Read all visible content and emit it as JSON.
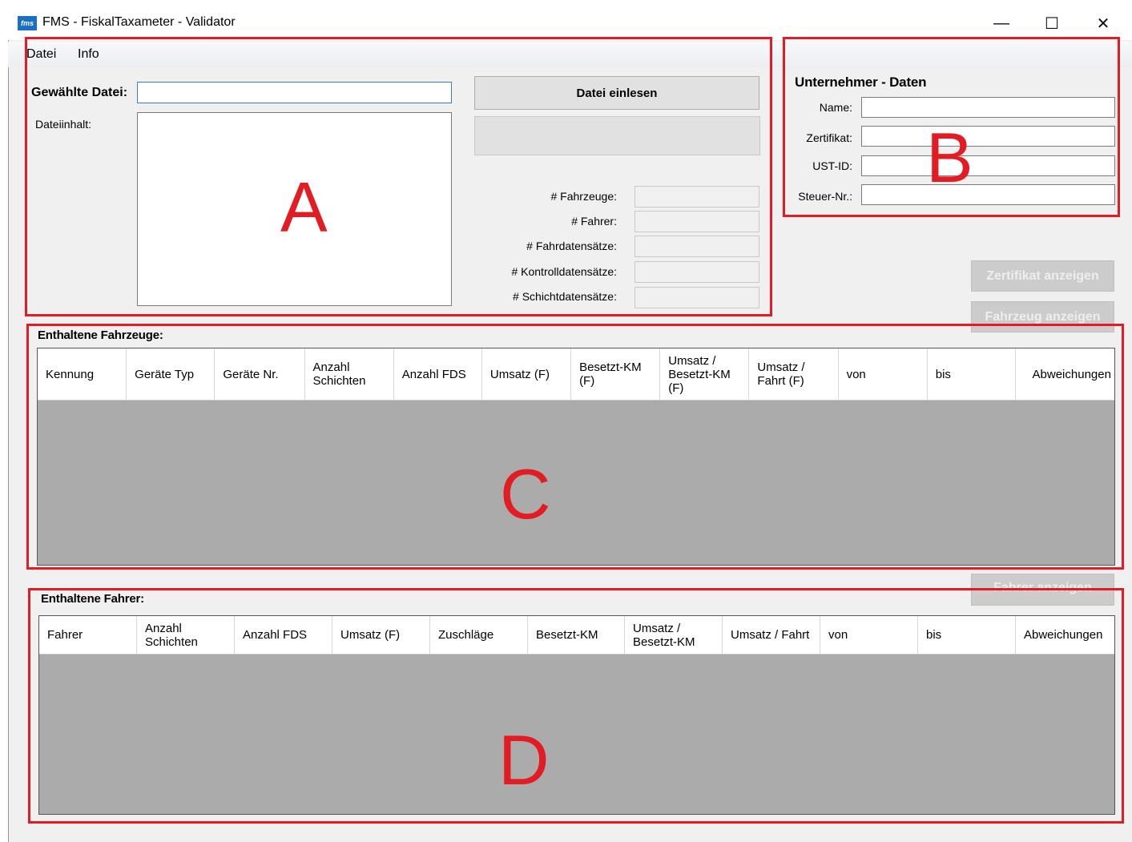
{
  "window": {
    "title": "FMS - FiskalTaxameter - Validator",
    "app_icon": "fms",
    "controls": {
      "minimize": "—",
      "maximize": "☐",
      "close": "✕"
    }
  },
  "menu": {
    "items": [
      "Datei",
      "Info"
    ]
  },
  "file_section": {
    "selected_file_label": "Gewählte Datei:",
    "selected_file_value": "",
    "content_label": "Dateiinhalt:",
    "read_button": "Datei einlesen",
    "stats": [
      {
        "label": "# Fahrzeuge:",
        "value": ""
      },
      {
        "label": "# Fahrer:",
        "value": ""
      },
      {
        "label": "# Fahrdatensätze:",
        "value": ""
      },
      {
        "label": "# Kontrolldatensätze:",
        "value": ""
      },
      {
        "label": "# Schichtdatensätze:",
        "value": ""
      }
    ]
  },
  "company": {
    "title": "Unternehmer - Daten",
    "fields": [
      {
        "label": "Name:",
        "value": ""
      },
      {
        "label": "Zertifikat:",
        "value": ""
      },
      {
        "label": "UST-ID:",
        "value": ""
      },
      {
        "label": "Steuer-Nr.:",
        "value": ""
      }
    ]
  },
  "buttons": {
    "show_certificate": "Zertifikat anzeigen",
    "show_vehicle": "Fahrzeug anzeigen",
    "show_driver": "Fahrer anzeigen"
  },
  "vehicles": {
    "title": "Enthaltene Fahrzeuge:",
    "columns": [
      "Kennung",
      "Geräte Typ",
      "Geräte Nr.",
      "Anzahl Schichten",
      "Anzahl FDS",
      "Umsatz (F)",
      "Besetzt-KM (F)",
      "Umsatz / Besetzt-KM (F)",
      "Umsatz / Fahrt (F)",
      "von",
      "bis",
      "Abweichungen"
    ]
  },
  "drivers": {
    "title": "Enthaltene Fahrer:",
    "columns": [
      "Fahrer",
      "Anzahl Schichten",
      "Anzahl FDS",
      "Umsatz (F)",
      "Zuschläge",
      "Besetzt-KM",
      "Umsatz / Besetzt-KM",
      "Umsatz / Fahrt",
      "von",
      "bis",
      "Abweichungen"
    ]
  },
  "annotations": {
    "a": "A",
    "b": "B",
    "c": "C",
    "d": "D"
  },
  "colors": {
    "annotation_red": "#e31b23",
    "grid_bg": "#ababab",
    "window_bg": "#f0f0f0"
  }
}
